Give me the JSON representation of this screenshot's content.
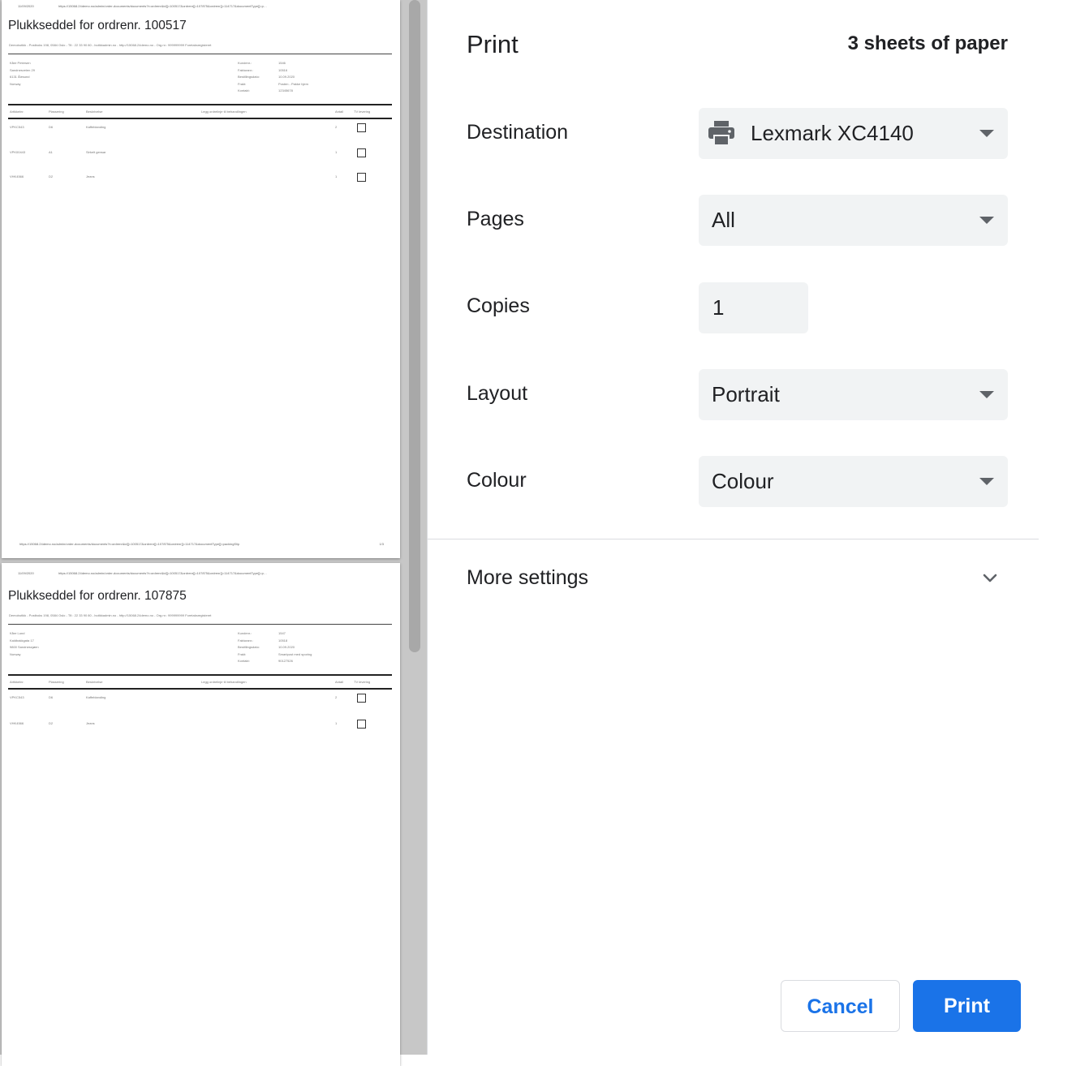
{
  "preview": {
    "sheets": [
      {
        "header_date": "11/09/2020",
        "header_url": "https://15068.24demo.no/admin/order-documents/documents?t=ordrenr&id[]=100517&ordrenr[]=107875&ordrenr[]=114717&documentType[]=p…",
        "title": "Plukkseddel for ordrenr. 100517",
        "company": "Demobutikk - Postboks 198, 0584 Oslo - Tlf.: 22 33 90 80 - butikkadmin.no - http://15068.24demo.no - Org.nr.: 999999999 Foretaksregisteret",
        "address": [
          "Kåre Petersen",
          "Sandnesveien 29",
          "6131 Ålesund",
          "Norway"
        ],
        "info_labels": [
          "Kundenr.:",
          "Fakturanr.:",
          "Bestillingsdato:",
          "Frakt:",
          "Kontakt:"
        ],
        "info_values": [
          "1546",
          "10516",
          "10.09.2020",
          "Posten - Pakke hjem",
          "12345678"
        ],
        "columns": [
          "Artikkelnr.",
          "Plassering",
          "Beskrivelse",
          "Legg ordrelinje til behandlingen",
          "Antall",
          "TV levering"
        ],
        "rows": [
          [
            "VPKC543",
            "D6",
            "Kaffeblanding",
            "2"
          ],
          [
            "VPK00443",
            "A1",
            "Sirkelt gensar",
            "1"
          ],
          [
            "VHK4566",
            "D2",
            "Jeans",
            "1"
          ]
        ],
        "footer_url": "https://15068.24demo.no/admin/order-documents/documents?t=ordrenr&id[]=100517&ordrenr[]=107875&ordrenr[]=114717&documentType[]=packingSlip",
        "footer_page": "1/3"
      },
      {
        "header_date": "11/09/2020",
        "header_url": "https://15068.24demo.no/admin/order-documents/documents?t=ordrenr&id[]=100517&ordrenr[]=107875&ordrenr[]=114717&documentType[]=p…",
        "title": "Plukkseddel for ordrenr. 107875",
        "company": "Demobutikk - Postboks 198, 0584 Oslo - Tlf.: 22 33 90 80 - butikkadmin.no - http://15068.24demo.no - Org.nr.: 999999999 Foretaksregisteret",
        "address": [
          "Kåre Lund",
          "Kaldbakkgata 17",
          "9800 Sandnessjøen",
          "Norway"
        ],
        "info_labels": [
          "Kundenr.:",
          "Fakturanr.:",
          "Bestillingsdato:",
          "Frakt:",
          "Kontakt:"
        ],
        "info_values": [
          "1547",
          "10518",
          "10.09.2020",
          "Smartpost med sporing",
          "90127526"
        ],
        "columns": [
          "Artikkelnr.",
          "Plassering",
          "Beskrivelse",
          "Legg ordrelinje til behandlingen",
          "Antall",
          "TV levering"
        ],
        "rows": [
          [
            "VPKC543",
            "D6",
            "Kaffeblanding",
            "2"
          ],
          [
            "VHK4566",
            "D2",
            "Jeans",
            "1"
          ]
        ]
      }
    ]
  },
  "panel": {
    "title": "Print",
    "sheets_count": "3 sheets of paper",
    "destination": {
      "label": "Destination",
      "value": "Lexmark XC4140",
      "icon": "printer-icon"
    },
    "pages": {
      "label": "Pages",
      "value": "All"
    },
    "copies": {
      "label": "Copies",
      "value": "1"
    },
    "layout": {
      "label": "Layout",
      "value": "Portrait"
    },
    "colour": {
      "label": "Colour",
      "value": "Colour"
    },
    "more_settings": {
      "label": "More settings",
      "icon": "chevron-down-icon"
    },
    "cancel_label": "Cancel",
    "print_label": "Print"
  },
  "colors": {
    "accent": "#1a73e8",
    "field_bg": "#f1f3f4",
    "preview_bg": "#c7c7c7"
  }
}
